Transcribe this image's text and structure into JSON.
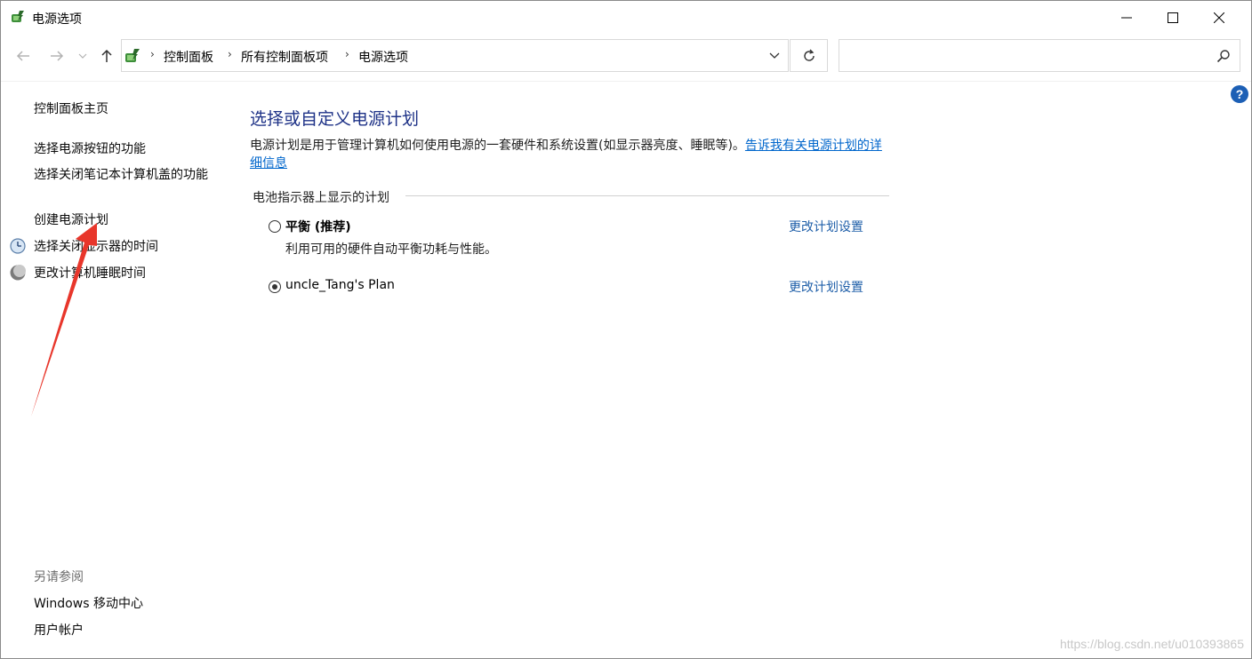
{
  "window": {
    "title": "电源选项"
  },
  "address": {
    "breadcrumbs": [
      "控制面板",
      "所有控制面板项",
      "电源选项"
    ],
    "search_placeholder": ""
  },
  "sidebar": {
    "home": "控制面板主页",
    "items": [
      "选择电源按钮的功能",
      "选择关闭笔记本计算机盖的功能",
      "创建电源计划",
      "选择关闭显示器的时间",
      "更改计算机睡眠时间"
    ],
    "see_also_title": "另请参阅",
    "see_also": [
      "Windows 移动中心",
      "用户帐户"
    ]
  },
  "main": {
    "heading": "选择或自定义电源计划",
    "description": "电源计划是用于管理计算机如何使用电源的一套硬件和系统设置(如显示器亮度、睡眠等)。",
    "description_link": "告诉我有关电源计划的详细信息",
    "group_label": "电池指示器上显示的计划",
    "plans": [
      {
        "name": "平衡 (推荐)",
        "description": "利用可用的硬件自动平衡功耗与性能。",
        "selected": false,
        "link": "更改计划设置"
      },
      {
        "name": "uncle_Tang's Plan",
        "description": "",
        "selected": true,
        "link": "更改计划设置"
      }
    ]
  },
  "watermark": "https://blog.csdn.net/u010393865",
  "colors": {
    "heading": "#1e3287",
    "link": "#1e5ea8",
    "arrow": "#e8362b"
  }
}
